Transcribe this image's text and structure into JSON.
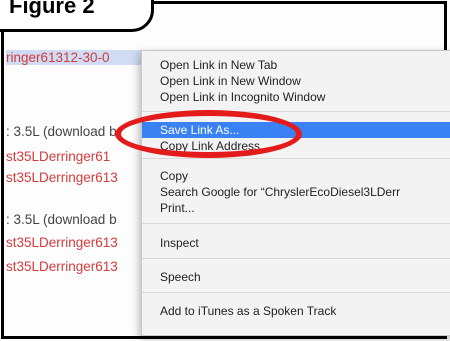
{
  "callout": {
    "text": "Figure 2"
  },
  "page": {
    "lines": [
      {
        "text": "ringer61312-30-0",
        "style": "link-red sel"
      },
      {
        "text": ": 3.5L (download b",
        "style": "txt-gray"
      },
      {
        "text": "st35LDerringer61",
        "style": "link-red"
      },
      {
        "text": "st35LDerringer613",
        "style": "link-red"
      },
      {
        "text": ": 3.5L (download b",
        "style": "txt-gray"
      },
      {
        "text": "st35LDerringer613",
        "style": "link-red"
      },
      {
        "text": "st35LDerringer613",
        "style": "link-red"
      }
    ]
  },
  "menu": {
    "items": [
      "Open Link in New Tab",
      "Open Link in New Window",
      "Open Link in Incognito Window",
      "Save Link As...",
      "Copy Link Address",
      "Copy",
      "Search Google for “ChryslerEcoDiesel3LDerr",
      "Print...",
      "Inspect",
      "Speech",
      "Add to iTunes as a Spoken Track"
    ]
  },
  "colors": {
    "highlight_ring": "#e31b1b",
    "menu_hover": "#3a82f4",
    "link": "#d23b3b"
  }
}
